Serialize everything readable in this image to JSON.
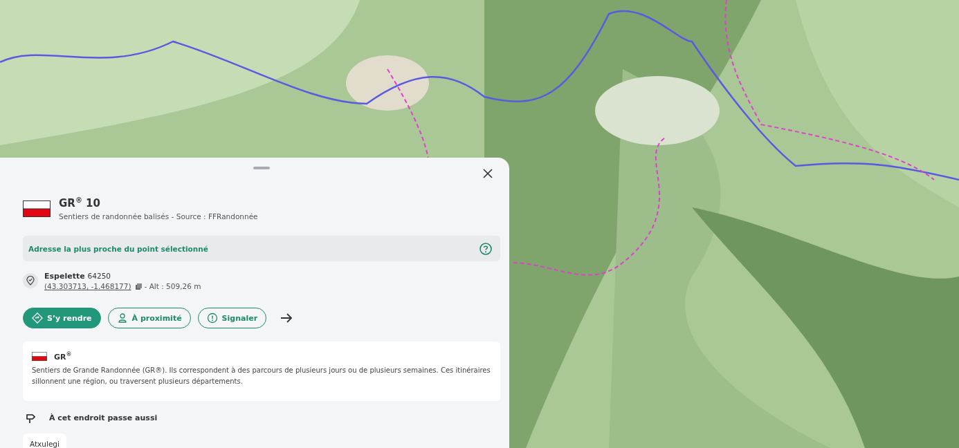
{
  "panel": {
    "title": "GR$^{®}$ 10",
    "subtitle": "Sentiers de randonnée balisés - Source : FFRandonnée",
    "address_banner": "Adresse la plus proche du point sélectionné",
    "location": {
      "place": "Espelette",
      "postcode": "64250",
      "coordinates": "(43.303713, -1.468177)",
      "altitude": "- Alt : 509,26 m"
    },
    "actions": [
      {
        "label": "S’y rendre",
        "kind": "primary"
      },
      {
        "label": "À proximité",
        "kind": "nearby"
      },
      {
        "label": "Signaler",
        "kind": "report"
      }
    ],
    "info_card": {
      "title": "GR$^{®}$",
      "text": "Sentiers de Grande Randonnée (GR®). Ils correspondent à des parcours de plusieurs jours ou de plusieurs semaines. Ces itinéraires sillonnent une région, ou traversent plusieurs départements."
    },
    "passes_heading": "À cet endroit passe aussi",
    "passes": [
      {
        "label": "Atxulegi"
      }
    ]
  }
}
